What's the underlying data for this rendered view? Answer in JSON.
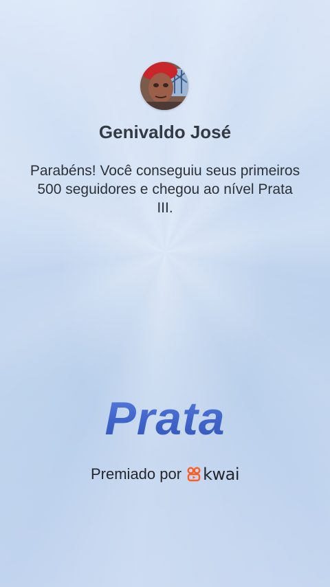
{
  "profile": {
    "name": "Genivaldo José",
    "avatar_icon": "user-avatar"
  },
  "message": "Parabéns! Você conseguiu seus primeiros 500 seguidores e chegou ao nível Prata III.",
  "level": {
    "title": "Prata",
    "color": "#3f63c8"
  },
  "award": {
    "label": "Premiado por",
    "brand_icon": "kwai-icon",
    "brand_name": "kwai",
    "brand_color": "#ff5a1f"
  }
}
